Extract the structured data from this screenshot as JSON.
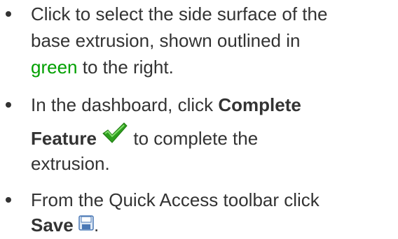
{
  "steps": [
    {
      "line1": "Click to select the side surface of the",
      "line2": "base extrusion, shown outlined in",
      "highlight": "green",
      "line3_rest": " to the right."
    },
    {
      "line1_prefix": "In the dashboard, click ",
      "line1_bold": "Complete",
      "line2_bold": "Feature",
      "icon": "green-checkmark-icon",
      "line2_rest": " to complete the",
      "line3": "extrusion."
    },
    {
      "line1": "From the Quick Access toolbar click",
      "line2_bold": "Save",
      "icon": "save-disk-icon",
      "line2_rest": "."
    }
  ],
  "colors": {
    "text": "#333333",
    "highlight_green": "#00a000",
    "check_green": "#2e9e1e"
  }
}
